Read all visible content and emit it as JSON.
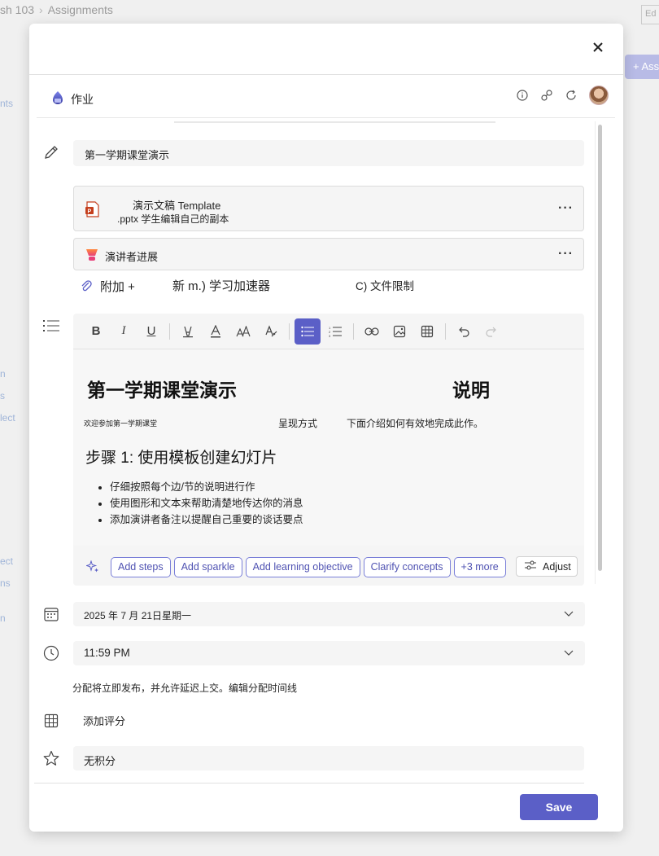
{
  "background": {
    "breadcrumb_course": "sh 103",
    "breadcrumb_page": "Assignments",
    "assign_button": "+ Assi",
    "corner_text": "Ed",
    "side_labels": [
      "nts",
      "n",
      "s",
      "lect",
      "ect",
      "ns",
      "n"
    ]
  },
  "dialog": {
    "app_title": "作业",
    "title_value": "第一学期课堂演示",
    "template_card": {
      "line1": "演示文稿 Template",
      "line2": ".pptx 学生编辑自己的副本",
      "more": "···"
    },
    "speaker_card": {
      "label": "演讲者进展",
      "more": "···"
    },
    "attach_row": {
      "attach": "附加 +",
      "new": "新 m.) 学习加速器",
      "limit": "C) 文件限制"
    },
    "toolbar": {
      "bold": "B",
      "italic": "I",
      "underline": "U"
    },
    "instructions": {
      "heading_left": "第一学期课堂演示",
      "heading_right": "说明",
      "small_1": "欢迎参加第一学期课堂",
      "small_2": "呈现方式",
      "small_3": "下面介绍如何有效地完成此作。",
      "step_heading": "步骤 1: 使用模板创建幻灯片",
      "bullets": [
        "仔细按照每个边/节的说明进行作",
        "使用图形和文本来帮助清楚地传达你的消息",
        "添加演讲者备注以提醒自己重要的谈话要点"
      ]
    },
    "ai_chips": [
      "Add steps",
      "Add sparkle",
      "Add learning objective",
      "Clarify concepts",
      "+3 more"
    ],
    "adjust_label": "Adjust",
    "due_date": "2025 年 7 月 21日星期一",
    "due_time": "11:59 PM",
    "publish_note": "分配将立即发布，并允许延迟上交。编辑分配时间线",
    "add_grading": "添加评分",
    "points_value": "无积分",
    "save_label": "Save"
  },
  "colors": {
    "accent": "#5b5fc7",
    "chip_border": "#7a7fd8",
    "field_bg": "#f5f5f5"
  }
}
